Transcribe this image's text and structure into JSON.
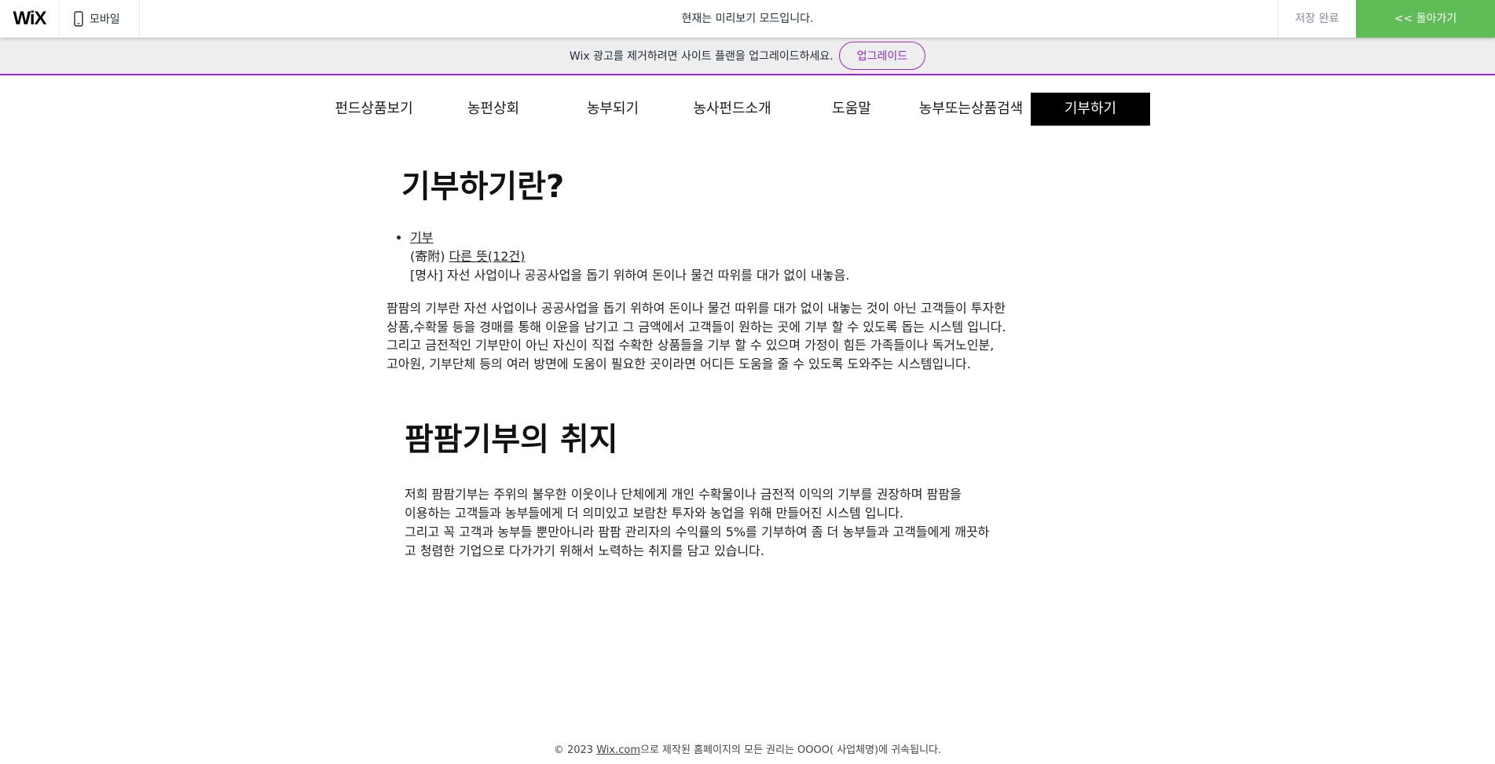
{
  "wix_bar": {
    "logo": "WiX",
    "mobile_label": "모바일",
    "preview_message": "현재는 미리보기 모드입니다.",
    "save_done": "저장 완료",
    "back_label": "<< 돌아가기"
  },
  "ad_banner": {
    "text": "Wix 광고를 제거하려면 사이트 플랜을 업그레이드하세요.",
    "upgrade_label": "업그레이드"
  },
  "nav": {
    "items": [
      {
        "label": "펀드상품보기"
      },
      {
        "label": "농펀상회"
      },
      {
        "label": "농부되기"
      },
      {
        "label": "농사펀드소개"
      },
      {
        "label": "도움말"
      },
      {
        "label": "농부또는상품검색"
      },
      {
        "label": "기부하기"
      }
    ],
    "active_index": 6
  },
  "content": {
    "title1": "기부하기란?",
    "dict": {
      "word": "기부",
      "hanja_open": "(寄附) ",
      "other_meaning": "다른 뜻",
      "count": "(12건)",
      "definition": "[명사] 자선 사업이나 공공사업을 돕기 위하여 돈이나 물건 따위를 대가 없이 내놓음."
    },
    "para1": [
      "팜팜의 기부란 자선 사업이나 공공사업을 돕기 위하여 돈이나 물건 따위를 대가 없이 내놓는 것이 아닌 고객들이 투자한",
      "상품,수확물 등을 경매를 통해 이윤을 남기고 그 금액에서 고객들이 원하는 곳에 기부 할 수 있도록 돕는 시스템 입니다.",
      "그리고 금전적인 기부만이 아닌 자신이 직접 수확한 상품들을 기부 할 수 있으며 가정이 힘든 가족들이나 독거노인분,",
      "고아원, 기부단체 등의 여러 방면에 도움이 필요한 곳이라면 어디든 도움을 줄 수 있도록 도와주는 시스템입니다."
    ],
    "title2": "팜팜기부의 취지",
    "para2": [
      "저희 팜팜기부는 주위의 불우한 이웃이나 단체에게 개인 수확물이나 금전적 이익의 기부를  권장하며 팜팜을",
      "이용하는 고객들과 농부들에게 더 의미있고 보람찬 투자와 농업을 위해 만들어진 시스템 입니다.",
      "그리고 꼭 고객과 농부들 뿐만아니라 팜팜 관리자의 수익률의 5%를 기부하여 좀 더 농부들과 고객들에게 깨끗하",
      "고 청렴한 기업으로 다가가기 위해서 노력하는 취지를 담고 있습니다."
    ]
  },
  "footer": {
    "prefix": "© 2023  ",
    "link": "Wix.com",
    "suffix": "으로 제작된 홈페이지의 모든 권리는  OOOO( 사업체명)에 귀속됩니다."
  },
  "colors": {
    "back_button": "#60bc57",
    "upgrade_accent": "#9a27d5",
    "active_nav": "#000000"
  }
}
